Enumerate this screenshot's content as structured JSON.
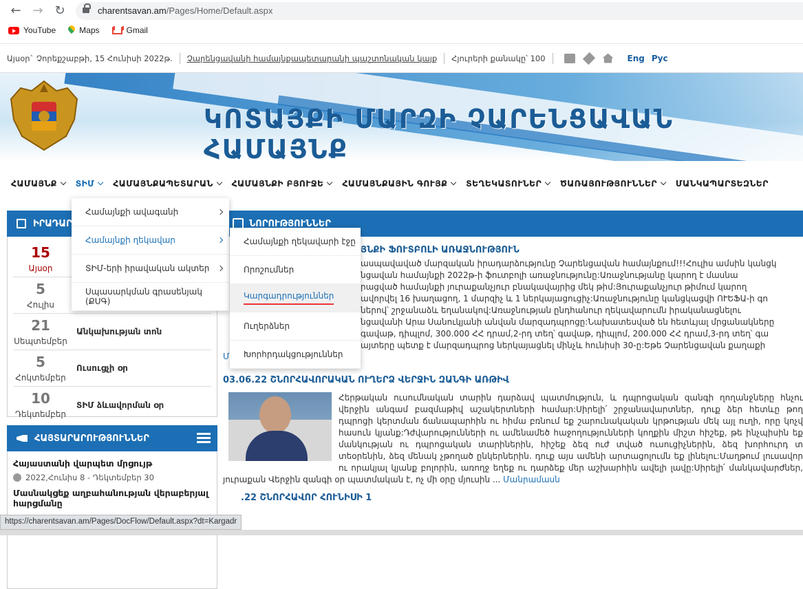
{
  "browser": {
    "url_host": "charentsavan.am",
    "url_path": "/Pages/Home/Default.aspx",
    "bookmarks": [
      {
        "label": "YouTube",
        "icon": "youtube-icon"
      },
      {
        "label": "Maps",
        "icon": "maps-icon"
      },
      {
        "label": "Gmail",
        "icon": "gmail-icon"
      }
    ],
    "status_url": "https://charentsavan.am/Pages/DocFlow/Default.aspx?dt=Kargadr"
  },
  "infobar": {
    "today": "Այսօր` Չորեքշաբթի, 15 Հունիսի 2022թ.",
    "official_site": "Չարենցավանի համայնքապետարանի պաշտոնական կայք",
    "visitors": "Հյուրերի քանակը՝ 100",
    "lang_en": "Eng",
    "lang_ru": "Рус"
  },
  "banner": {
    "title": "ԿՈՏԱՅՔԻ ՄԱՐԶԻ ՉԱՐԵՆՑԱՎԱՆ ՀԱՄԱՅՆՔ"
  },
  "menu": [
    {
      "label": "ՀԱՄԱՅՆՔ",
      "active": false
    },
    {
      "label": "ՏԻՄ",
      "active": true
    },
    {
      "label": "ՀԱՄԱՅՆՔԱՊԵՏԱՐԱՆ",
      "active": false
    },
    {
      "label": "ՀԱՄԱՅՆՔԻ ԲՅՈՒՋԵ",
      "active": false
    },
    {
      "label": "ՀԱՄԱՅՆՔԱՅԻՆ ԳՈՒՅՔ",
      "active": false
    },
    {
      "label": "ՏԵՂԵԿԱՏՈՒՆԵՐ",
      "active": false
    },
    {
      "label": "ԾԱՌԱՅՈՒԹՅՈՒՆՆԵՐ",
      "active": false
    },
    {
      "label": "ՄԱՆԿԱՊԱՐՏԵԶՆԵՐ",
      "active": false
    }
  ],
  "dropdown1": [
    {
      "label": "Համայնքի ավագանի",
      "arrow": true
    },
    {
      "label": "Համայնքի ղեկավար",
      "arrow": true
    },
    {
      "label": "ՏԻՄ-երի իրավական ակտեր",
      "arrow": true
    },
    {
      "label": "Սպասարկման գրասենյակ (ՔՍԳ)",
      "arrow": false
    }
  ],
  "dropdown2": [
    "Համայնքի ղեկավարի էջը",
    "Որոշումներ",
    "Կարգադրություններ",
    "Ուղերձներ",
    "Խորհրդակցություններ"
  ],
  "calendar": {
    "header": "ԻՐԱԴԱՐ",
    "events": [
      {
        "num": "15",
        "month": "Այսօր",
        "name": "",
        "today": true
      },
      {
        "num": "5",
        "month": "Հուլիս",
        "name": ""
      },
      {
        "num": "21",
        "month": "Սեպտեմբեր",
        "name": "Անկախության տոն"
      },
      {
        "num": "5",
        "month": "Հոկտեմբեր",
        "name": "Ուսուցչի օր"
      },
      {
        "num": "10",
        "month": "Դեկտեմբեր",
        "name": "ՏԻՄ ձևավորման օր"
      }
    ]
  },
  "announcements": {
    "header": "ՀԱՅՏԱՐԱՐՈՒԹՅՈՒՆՆԵՐ",
    "items": [
      {
        "title": "Հայաստանի վարպետ մրցույթ",
        "date": "2022,Հունիս 8 - Դեկտեմբեր 30"
      },
      {
        "title": "Մասնակցեք աղբահանության վերաբերյալ հարցմանը",
        "date": ""
      }
    ]
  },
  "news": {
    "header": "ՆՈՐՈՒԹՅՈՒՆՆԵՐ",
    "item1_title": "ՅՆՔԻ ՖՈՒՏԲՈԼԻ ԱՌԱՋՆՈՒԹՅՈՒՆ",
    "item1_lines": [
      "ասպավաված մարզական իրադարձությունը Չարենցավան համայնքում!!!Հուլիս ամսին կանցկ",
      "նցավան համայնքի 2022թ-ի ֆուտբոլի առաջնությունը:Առաջնությանը կարող է մասնա",
      "րացված համայնքի յուրաքանչյուր բնակավայրից մեկ թիմ:Յուրաքանչյուր թիմում կարող",
      "ավորվել 16 խաղացող, 1 մարզիչ և 1 ներկայացուցիչ:Առաջնությունը կանցկացվի ՈՒԵՖԱ-ի գո",
      "ներով՝ շրջանաձև եղանակով:Առաջնության ընդհանուր ղեկավարումն իրականացնելու",
      "նցավանի Արա Սանուկյանի անվան մարզադպրոցը:Նախատեսված են հետևյալ մրցանակները",
      "գավաթ, դիպլոմ, 300.000 ՀՀ դրամ,2-րդ տեղ՝ գավաթ, դիպլոմ, 200.000 ՀՀ դրամ,3-րդ տեղ՝ գա",
      "այտերը պետք է մարզադպրոց ներկայացնել մինչև հունիսի 30-ը:Եթե Չարենցավան քաղաքի"
    ],
    "more": "Մանրամասն",
    "item2_title": "03.06.22 ՇՆՈՐՀԱՎՈՐԱԿԱՆ ՈՒՂԵՐՁ ՎԵՐՋԻՆ ԶԱՆԳԻ ԱՌԹԻՎ",
    "item2_text": "Հերթական ուսումնական տարին դարձավ պատմություն, և դպրոցական զանգի ղողանջները հնչու վերջին անգամ բազմաթիվ աշակերտների համար:Սիրելի՛ շրջանավարտներ, դուք ձեր հետևը թող դպրոցի կերտման ճանապարհին ու հիմա բռնում եք շարունակական կրթության մեկ այլ ուղի, որը կոչվ հասուն կյանք:Դժվարությունների ու ամենամեծ հաջողությունների կողքին միշտ հիշեք, թե ինչպիսին եք մանկության ու դպրոցական տարիներին, հիշեք ձեզ ուժ տված ուսուցիչներին, ձեզ խորհուրդ տ տեօրենին, ձեզ մենակ չթողած ընկերներին. դուք այս ամենի արտացոլումն եք լինելու:Մաղթում լուսավոր ու որակյալ կյանք բոլորին, առողջ եղեք ու դարձեք մեր աշխարհին ավելի լավը:Սիրելի՛ մանկավարժներ, յուրաքան Վերջին զանգի օր պատմական է, ոչ մի օրը մյուսին ...",
    "item3_title": ".22 ՇՆՈՐՀԱՎՈՐ ՀՈՒՆԻՍԻ 1"
  }
}
